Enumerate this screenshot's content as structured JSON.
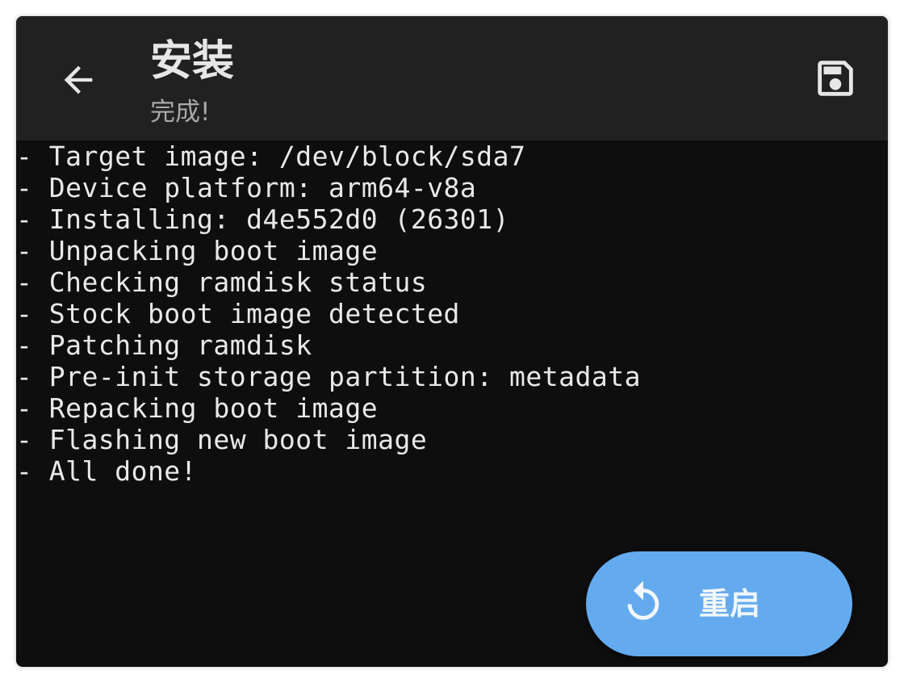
{
  "header": {
    "title": "安装",
    "subtitle": "完成!",
    "back_icon": "arrow-left-icon",
    "save_icon": "save-icon"
  },
  "console": {
    "lines": [
      "- Target image: /dev/block/sda7",
      "- Device platform: arm64-v8a",
      "- Installing: d4e552d0 (26301)",
      "- Unpacking boot image",
      "- Checking ramdisk status",
      "- Stock boot image detected",
      "- Patching ramdisk",
      "- Pre-init storage partition: metadata",
      "- Repacking boot image",
      "- Flashing new boot image",
      "- All done!"
    ]
  },
  "fab": {
    "label": "重启",
    "icon": "restart-icon"
  },
  "colors": {
    "appbar": "#212121",
    "console_bg": "#0e0e0e",
    "text": "#e9e9e9",
    "subtitle": "#a8a8a8",
    "accent": "#64aaee"
  }
}
